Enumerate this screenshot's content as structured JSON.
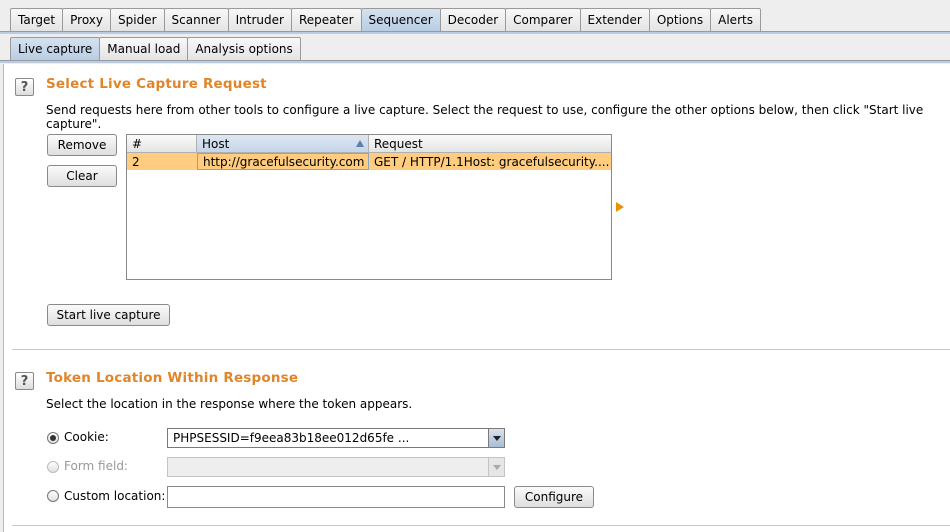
{
  "main_tabs": [
    "Target",
    "Proxy",
    "Spider",
    "Scanner",
    "Intruder",
    "Repeater",
    "Sequencer",
    "Decoder",
    "Comparer",
    "Extender",
    "Options",
    "Alerts"
  ],
  "main_active": "Sequencer",
  "sub_tabs": [
    "Live capture",
    "Manual load",
    "Analysis options"
  ],
  "sub_active": "Live capture",
  "capture": {
    "title": "Select Live Capture Request",
    "description": "Send requests here from other tools to configure a live capture. Select the request to use, configure the other options below, then click \"Start live capture\".",
    "remove_label": "Remove",
    "clear_label": "Clear",
    "start_label": "Start live capture",
    "table": {
      "columns": [
        "#",
        "Host",
        "Request"
      ],
      "rows": [
        [
          "2",
          "http://gracefulsecurity.com",
          "GET / HTTP/1.1Host: gracefulsecurity...."
        ]
      ]
    }
  },
  "token": {
    "title": "Token Location Within Response",
    "description": "Select the location in the response where the token appears.",
    "cookie_label": "Cookie:",
    "cookie_value": "PHPSESSID=f9eea83b18ee012d65fe ...",
    "form_label": "Form field:",
    "form_value": "",
    "custom_label": "Custom location:",
    "custom_value": "",
    "configure_label": "Configure"
  },
  "help_glyph": "?",
  "colors": {
    "accent": "#e0852a",
    "selected_row": "#ffcc80",
    "active_tab": "#b8cde3"
  }
}
